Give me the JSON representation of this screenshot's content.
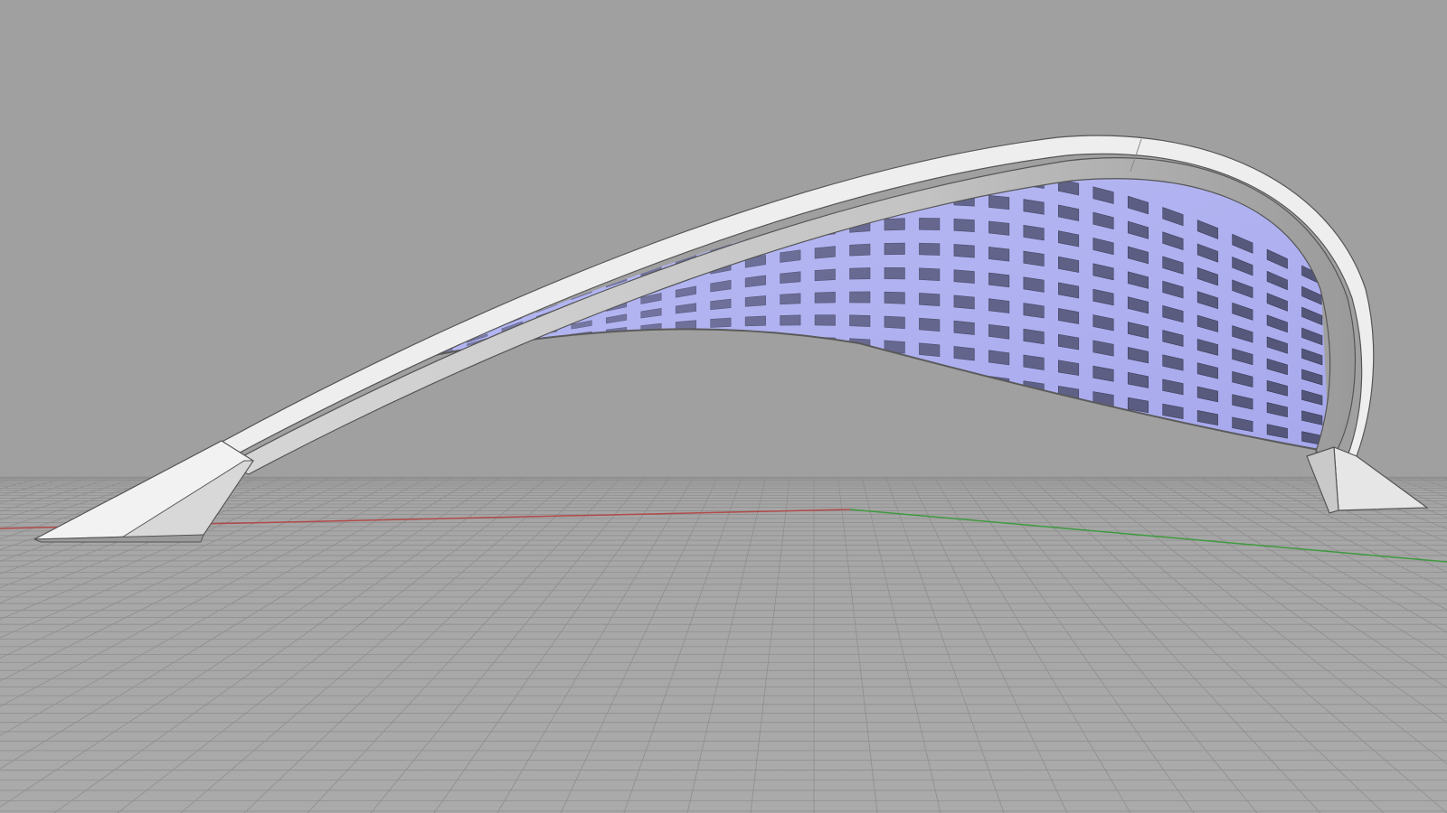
{
  "viewport": {
    "view_type": "perspective",
    "display_mode": "shaded",
    "background_color": "#a0a0a0",
    "grid": {
      "visible": true,
      "color": "#8e8e8e",
      "major_color": "#868686",
      "plane_color": "#a8a8a8"
    },
    "axes": {
      "x_axis_color": "#b24a4a",
      "y_axis_color": "#3f9a3f"
    }
  },
  "model": {
    "object": "arched-canopy-structure",
    "components": [
      {
        "name": "outer-arch-rib",
        "color": "#e4e4e4"
      },
      {
        "name": "inner-arch-face",
        "color": "#bdbdbd"
      },
      {
        "name": "lattice-membrane",
        "color": "#aeb0f0"
      },
      {
        "name": "lattice-panel",
        "color": "#4e5070"
      },
      {
        "name": "left-footing",
        "color": "#ececec"
      },
      {
        "name": "right-footing",
        "color": "#e0e0e0"
      }
    ]
  }
}
